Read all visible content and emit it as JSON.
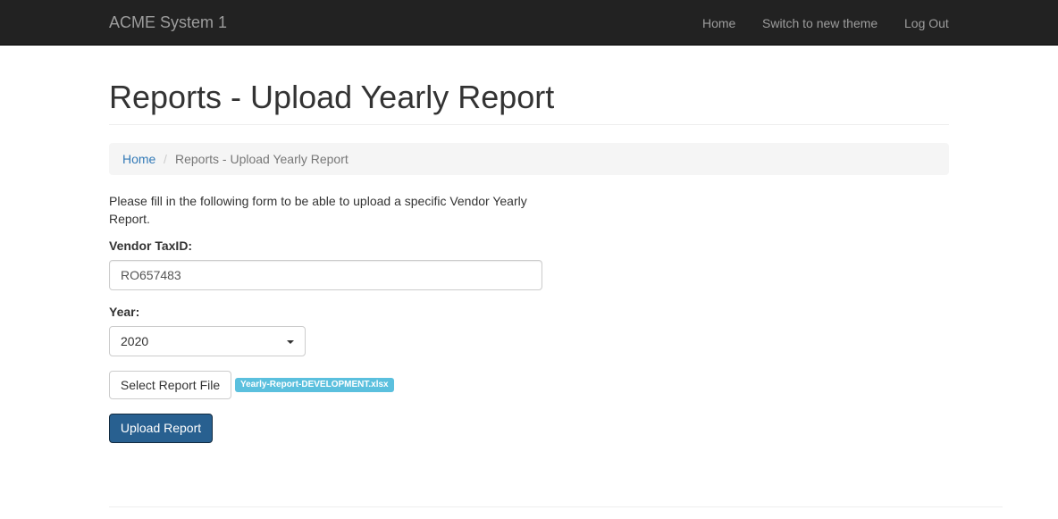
{
  "navbar": {
    "brand": "ACME System 1",
    "links": [
      {
        "label": "Home"
      },
      {
        "label": "Switch to new theme"
      },
      {
        "label": "Log Out"
      }
    ]
  },
  "page": {
    "title": "Reports - Upload Yearly Report"
  },
  "breadcrumb": {
    "home": "Home",
    "separator": "/",
    "current": "Reports - Upload Yearly Report"
  },
  "form": {
    "intro": "Please fill in the following form to be able to upload a specific Vendor Yearly Report.",
    "tax_label": "Vendor TaxID:",
    "tax_value": "RO657483",
    "year_label": "Year:",
    "year_value": "2020",
    "file_button": "Select Report File",
    "file_name": "Yearly-Report-DEVELOPMENT.xlsx",
    "submit_label": "Upload Report"
  },
  "colors": {
    "navbar_bg": "#222222",
    "link": "#337ab7",
    "primary_button": "#286090",
    "info_badge": "#5bc0de"
  }
}
